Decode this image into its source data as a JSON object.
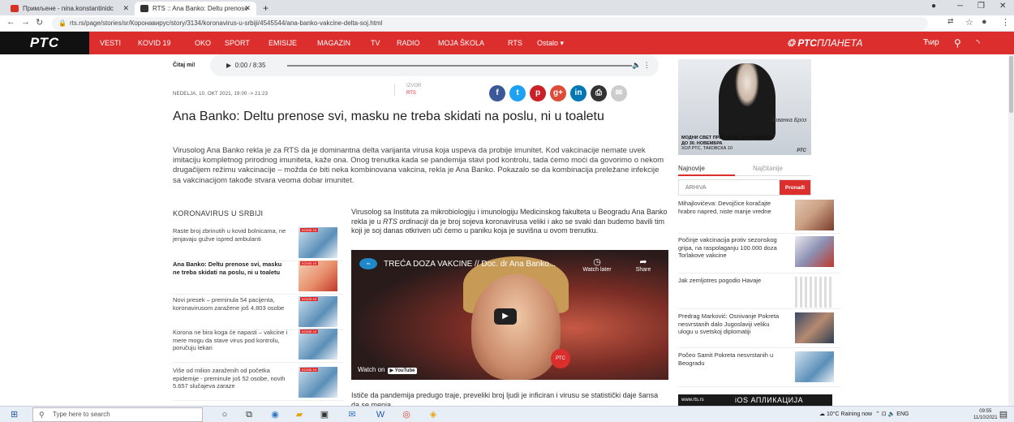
{
  "browser": {
    "tabs": [
      {
        "label": "Примљене - nina.konstantinidc",
        "favicon_color": "#d93025"
      },
      {
        "label": "RTS :: Ana Banko: Deltu prenose",
        "favicon_color": "#333333"
      }
    ],
    "url": "rts.rs/page/stories/sr/Коронавирус/story/3134/koronavirus-u-srbiji/4545544/ana-banko-vakcine-delta-soj.html",
    "new_tab": "+"
  },
  "site": {
    "logo": "РТС",
    "brand_red": "#dd2e2e",
    "nav": [
      "VESTI",
      "KOVID 19",
      "OKO",
      "SPORT",
      "EMISIJE",
      "MAGAZIN",
      "TV",
      "RADIO",
      "MOJA ŠKOLA",
      "RTS",
      "Ostalo ▾"
    ],
    "planeta_brand": "РТС",
    "planeta_word": "ПЛАНЕТА",
    "script_toggle": "Ћир"
  },
  "player": {
    "label": "Čitaj mi!",
    "time": "0:00 / 8:35"
  },
  "article": {
    "dateline": "NEDELJA, 10. OKT 2021, 19:00 -> 21:23",
    "source_label": "IZVOR",
    "source": "RTS",
    "headline": "Ana Banko: Deltu prenose svi, masku ne treba skidati na poslu, ni u toaletu",
    "lead": "Virusolog Ana Banko rekla je za RTS da je dominantna delta varijanta virusa koja uspeva da probije imunitet. Kod vakcinacije nemate uvek imitaciju kompletnog prirodnog imuniteta, kaže ona. Onog trenutka kada se pandemija stavi pod kontrolu, tada ćemo moći da govorimo o nekom drugačijem režimu vakcinacije – možda će biti neka kombinovana vakcina, rekla je Ana Banko. Pokazalo se da kombinacija preležane infekcije sa vakcinacijom takođe stvara veoma dobar imunitet.",
    "body_p1_a": "Virusolog sa Instituta za mikrobiologiju i imunologiju Medicinskog fakulteta u Beogradu  Ana Banko rekla je u ",
    "body_p1_show": "RTS ordinaciji",
    "body_p1_b": " da je broj sojeva koronavirusa veliki i ako se svaki dan budemo bavili tim koji je soj danas otkriven uči ćemo u paniku koja je suvišna u ovom trenutku.",
    "after_video": "Ističe da pandemija predugo traje, preveliki broj ljudi je inficiran i virusu se statistički daje šansa da se menja."
  },
  "social": [
    {
      "icon": "facebook-icon",
      "glyph": "f",
      "color": "#3b5998"
    },
    {
      "icon": "twitter-icon",
      "glyph": "t",
      "color": "#1da1f2"
    },
    {
      "icon": "pinterest-icon",
      "glyph": "p",
      "color": "#cb2027"
    },
    {
      "icon": "google-plus-icon",
      "glyph": "g+",
      "color": "#dd4b39"
    },
    {
      "icon": "linkedin-icon",
      "glyph": "in",
      "color": "#0077b5"
    },
    {
      "icon": "print-icon",
      "glyph": "⎙",
      "color": "#333333"
    },
    {
      "icon": "email-icon",
      "glyph": "✉",
      "color": "#cccccc"
    }
  ],
  "related": {
    "title": "KORONAVIRUS U SRBIJI",
    "items": [
      {
        "text": "Raste broj zbrinutih u kovid bolnicama, ne jenjavaju gužve ispred ambulanti",
        "tag": "KOVID 19",
        "bold": false
      },
      {
        "text": "Ana Banko: Deltu prenose svi, masku ne treba skidati na poslu, ni u toaletu",
        "tag": "KOVID 19",
        "bold": true
      },
      {
        "text": "Novi presek – preminula 54 pacijenta, koronavirusom zaražene još 4.803 osobe",
        "tag": "KOVID 19",
        "bold": false
      },
      {
        "text": "Korona ne bira koga će napasti – vakcine i mere mogu da stave virus pod kontrolu, poručuju lekari",
        "tag": "KOVID 19",
        "bold": false
      },
      {
        "text": "Više od milion zaraženih od početka epidemije - preminule još 52 osobe, novih 5.657 slučajeva zaraze",
        "tag": "KOVID 19",
        "bold": false
      }
    ]
  },
  "video": {
    "title": "TREĆA DOZA VAKCINE // Doc. dr Ana Banko...",
    "watch_later": "Watch later",
    "share": "Share",
    "watch_on": "Watch on",
    "youtube": "▶ YouTube"
  },
  "ad": {
    "name": "Јованка Броз",
    "line1": "МОДНИ СВЕТ ПРВЕ ДАМЕ ЈУГОСЛАВИЈЕ",
    "line2": "ДО 30. НОВЕМБРА",
    "line3": "ХОЛ РТС, ТАКОВСКА 10",
    "brand": "РТС"
  },
  "sidebar": {
    "tab_latest": "Najnovije",
    "tab_most_read": "Najčitanije",
    "archive_placeholder": "ARHIVA",
    "archive_button": "Pronađi",
    "news": [
      {
        "text": "Mihajlovićeva: Devojčice koračajte hrabro napred, niste manje vredne",
        "thumb": "th-a"
      },
      {
        "text": "Počinje vakcinacija protiv sezonskog gripa, na raspolaganju 100.000 doza Torlakove vakcine",
        "thumb": "th-b"
      },
      {
        "text": "Jak zemljotres pogodio Havaje",
        "thumb": "th-c"
      },
      {
        "text": "Predrag Marković: Osnivanje Pokreta nesvrstanih dalo Jugoslaviji veliku ulogu u svetskoj diplomatiji",
        "thumb": "th-d"
      },
      {
        "text": "Počeo Samit Pokreta nesvrstanih u Beogradu",
        "thumb": "th-e"
      }
    ],
    "ios_site": "www.rts.rs",
    "ios_text": "iOS АПЛИКАЦИЈА"
  },
  "taskbar": {
    "search_placeholder": "Type here to search",
    "weather": "10°C  Raining now",
    "lang": "ENG",
    "time": "09:55",
    "date": "11/10/2021"
  }
}
